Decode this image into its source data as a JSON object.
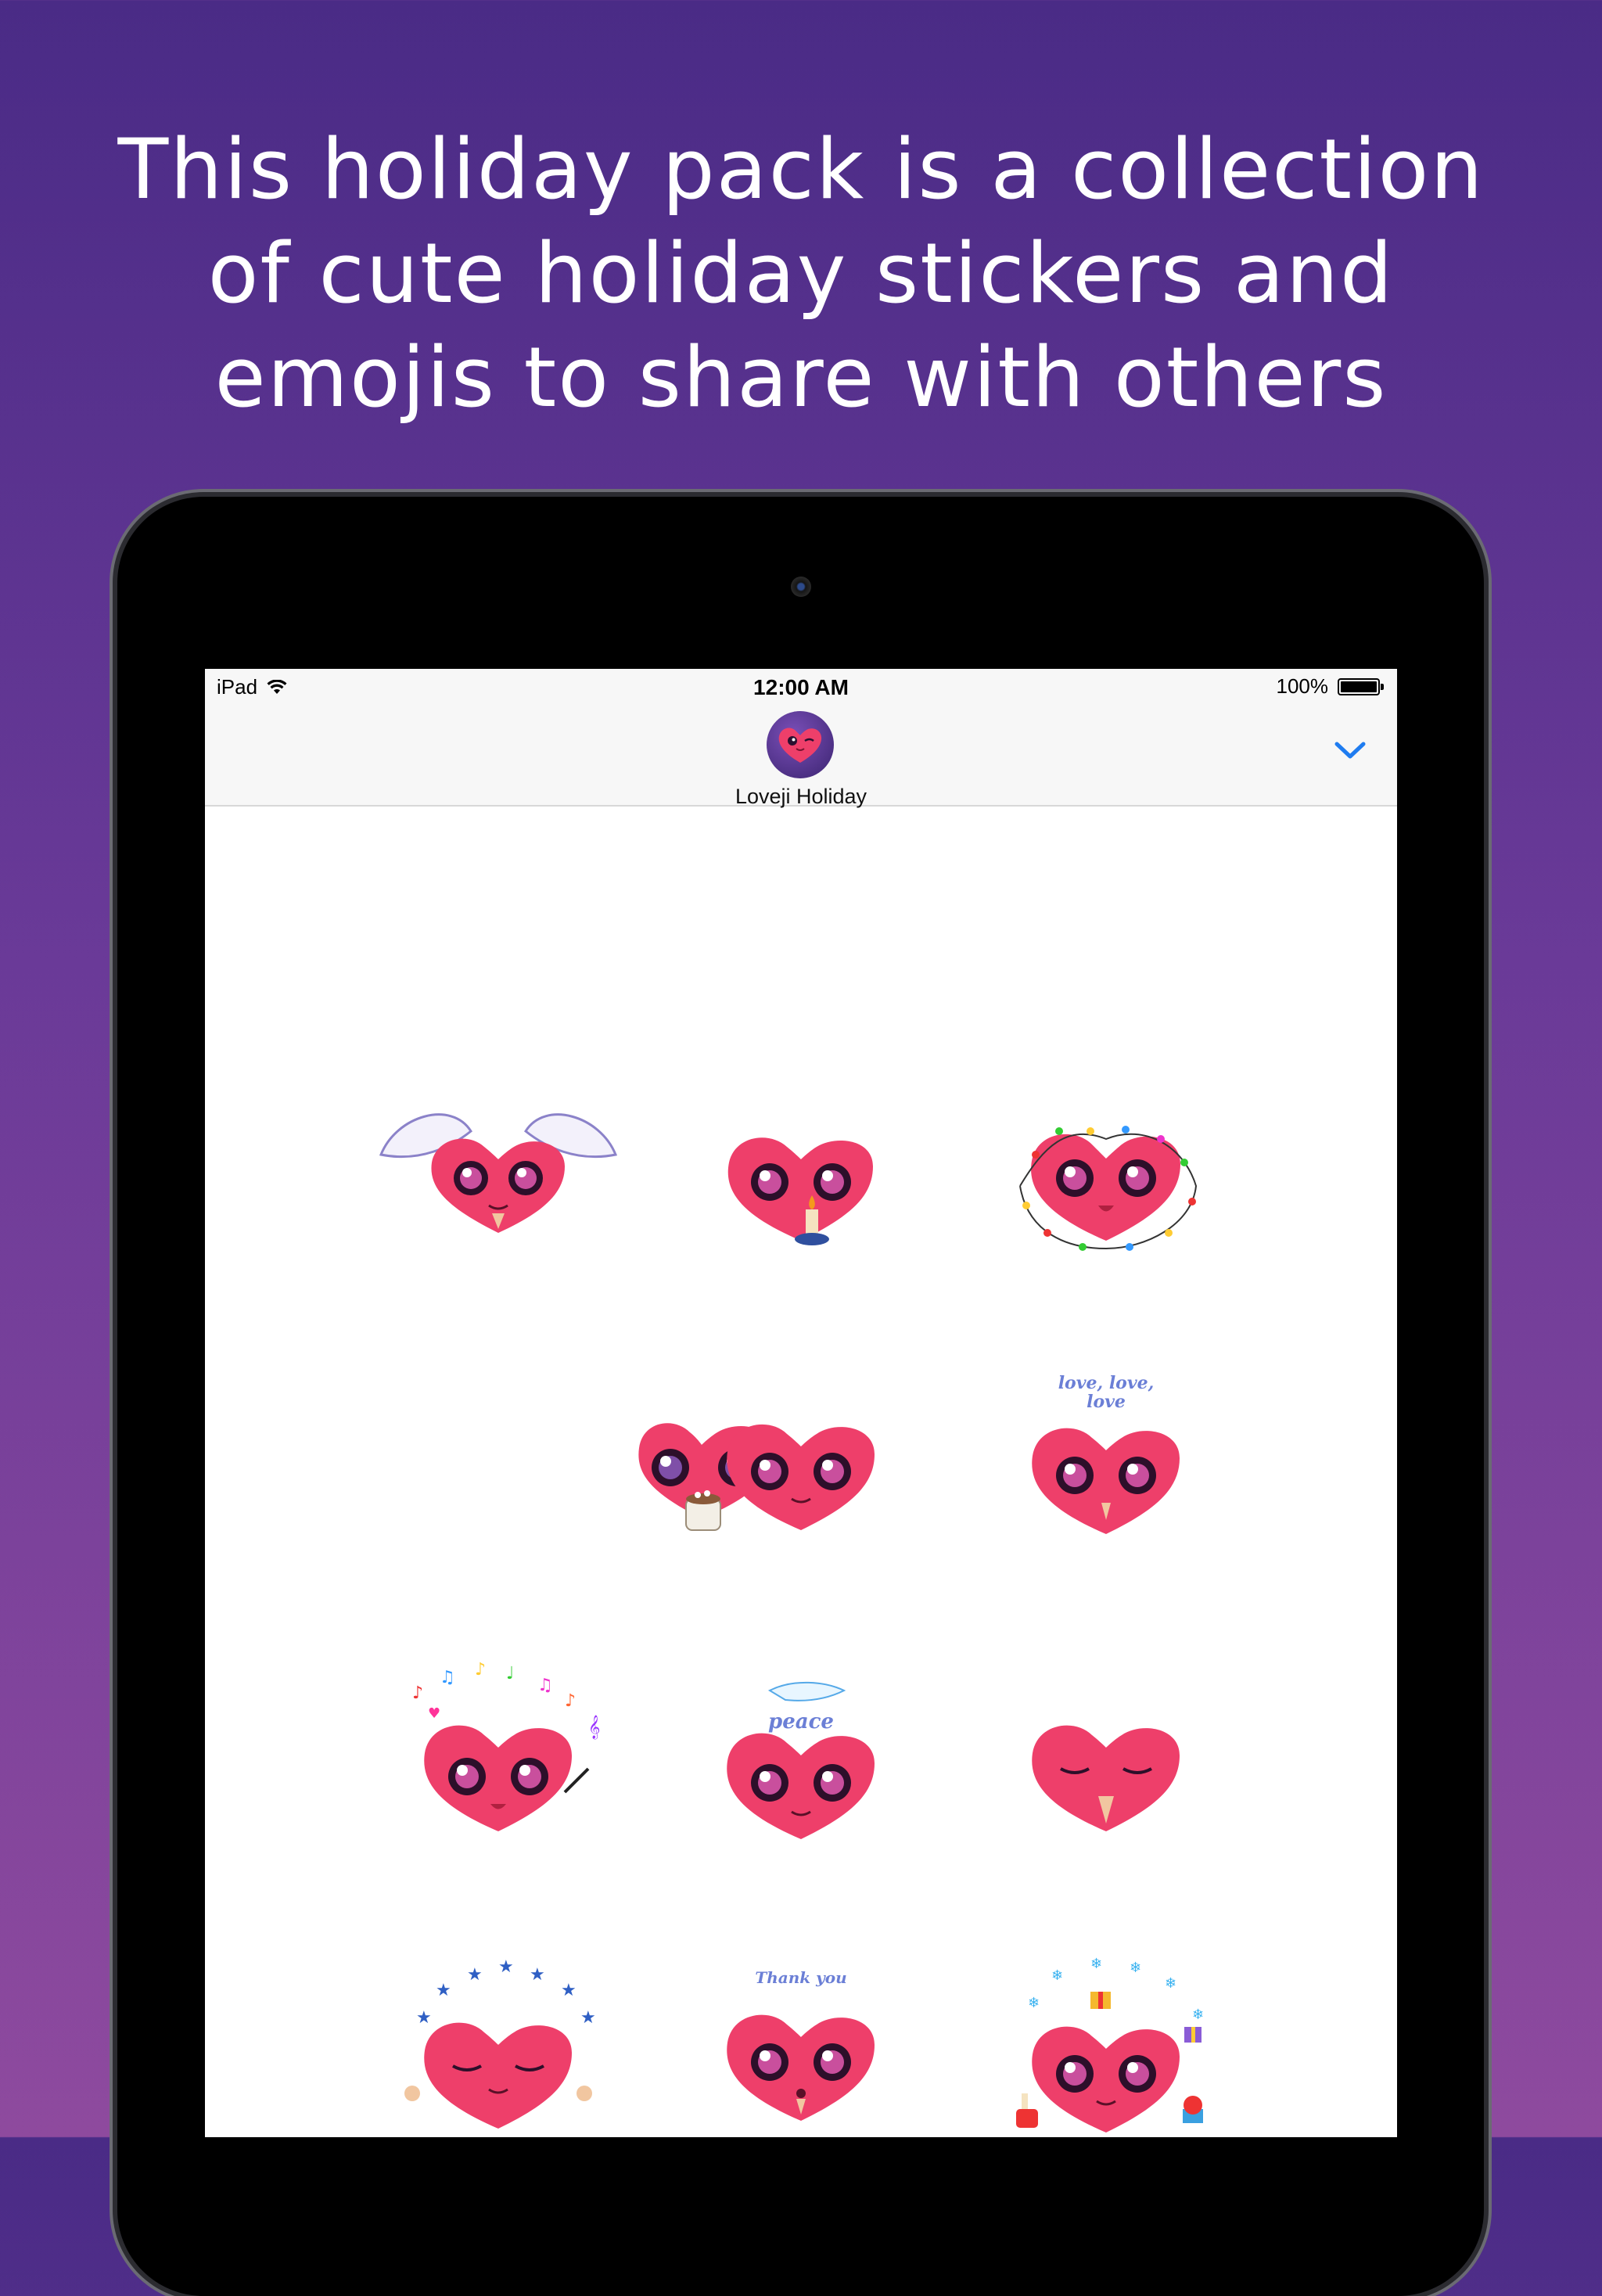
{
  "headline": {
    "line1": "This holiday pack is a collection",
    "line2": "of cute holiday stickers and",
    "line3": "emojis to share with others"
  },
  "status_bar": {
    "device": "iPad",
    "time": "12:00 AM",
    "battery": "100%"
  },
  "app": {
    "name": "Loveji Holiday",
    "collapse_icon": "chevron-down-icon",
    "accent_color": "#1f7cf0"
  },
  "colors": {
    "background_top": "#4a2b86",
    "background_bottom": "#8e4a9e",
    "heart": "#ee3f6a"
  },
  "stickers": [
    {
      "name": "angel-wings-heart",
      "caption": ""
    },
    {
      "name": "candle-heart",
      "caption": ""
    },
    {
      "name": "string-lights-heart",
      "caption": ""
    },
    {
      "name": "cocoa-mug-heart",
      "caption": ""
    },
    {
      "name": "smiling-heart",
      "caption": ""
    },
    {
      "name": "love-love-love-heart",
      "caption": "love, love,\nlove"
    },
    {
      "name": "music-notes-heart",
      "caption": ""
    },
    {
      "name": "peace-dove-heart",
      "caption": "peace"
    },
    {
      "name": "praying-heart",
      "caption": ""
    },
    {
      "name": "stars-heart",
      "caption": ""
    },
    {
      "name": "thank-you-heart",
      "caption": "Thank you"
    },
    {
      "name": "gifts-snowflakes-heart",
      "caption": ""
    }
  ]
}
